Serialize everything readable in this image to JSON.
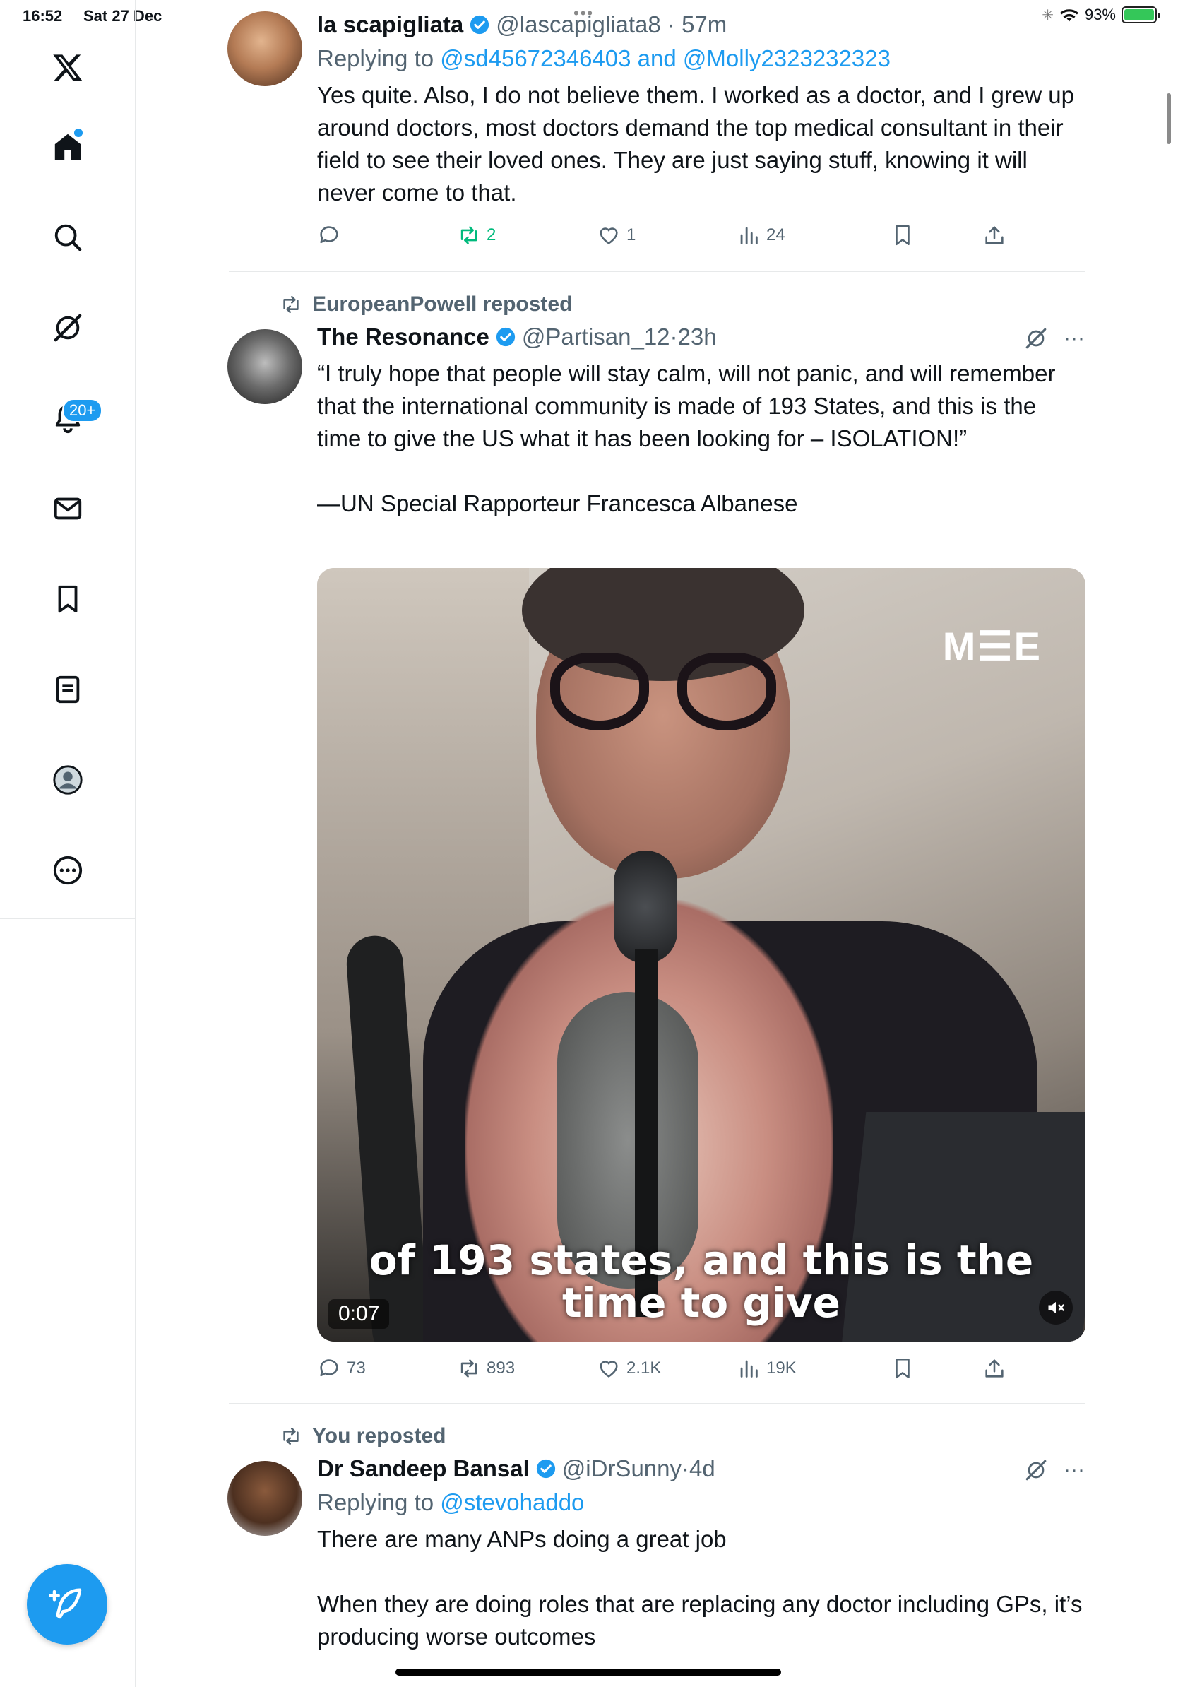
{
  "status_bar": {
    "time": "16:52",
    "date": "Sat 27 Dec",
    "battery": "93%"
  },
  "sidebar": {
    "notifications_badge": "20+",
    "items": [
      {
        "name": "x-logo-icon"
      },
      {
        "name": "home-icon"
      },
      {
        "name": "search-icon"
      },
      {
        "name": "grok-icon"
      },
      {
        "name": "notifications-icon"
      },
      {
        "name": "messages-icon"
      },
      {
        "name": "bookmarks-icon"
      },
      {
        "name": "lists-icon"
      },
      {
        "name": "profile-icon"
      },
      {
        "name": "more-icon"
      }
    ]
  },
  "tweets": [
    {
      "name": "la scapigliata",
      "handle": "@lascapigliata8",
      "time": "57m",
      "replying_prefix": "Replying to ",
      "replying_to": "@sd45672346403 and @Molly2323232323",
      "text": "Yes quite. Also, I do not believe them. I worked as a doctor, and I grew up around doctors, most doctors demand the top medical consultant in their field to see their loved ones. They are just saying stuff, knowing it will never come to that.",
      "stats": {
        "replies": "",
        "reposts": "2",
        "likes": "1",
        "views": "24"
      }
    },
    {
      "repost_by": "EuropeanPowell reposted",
      "name": "The Resonance",
      "handle": "@Partisan_12",
      "time": "23h",
      "text": "“I truly hope that people will stay calm, will not panic, and will remember that the international community is made of 193 States, and this is the time to give the US what it has been looking for – ISOLATION!”\n\n—UN Special Rapporteur Francesca Albanese",
      "video": {
        "logo": "M☰E",
        "caption_line1": "of 193 states, and this is the",
        "caption_line2": "time to give",
        "duration": "0:07"
      },
      "stats": {
        "replies": "73",
        "reposts": "893",
        "likes": "2.1K",
        "views": "19K"
      }
    },
    {
      "repost_by": "You reposted",
      "name": "Dr Sandeep Bansal",
      "handle": "@iDrSunny",
      "time": "4d",
      "replying_prefix": "Replying to ",
      "replying_to": "@stevohaddo",
      "text": "There are many ANPs doing a great job\n\nWhen they are doing roles that are replacing any doctor including GPs, it’s producing worse outcomes"
    }
  ],
  "colors": {
    "accent": "#1d9bf0",
    "muted": "#536471",
    "repost_green": "#00ba7c"
  }
}
